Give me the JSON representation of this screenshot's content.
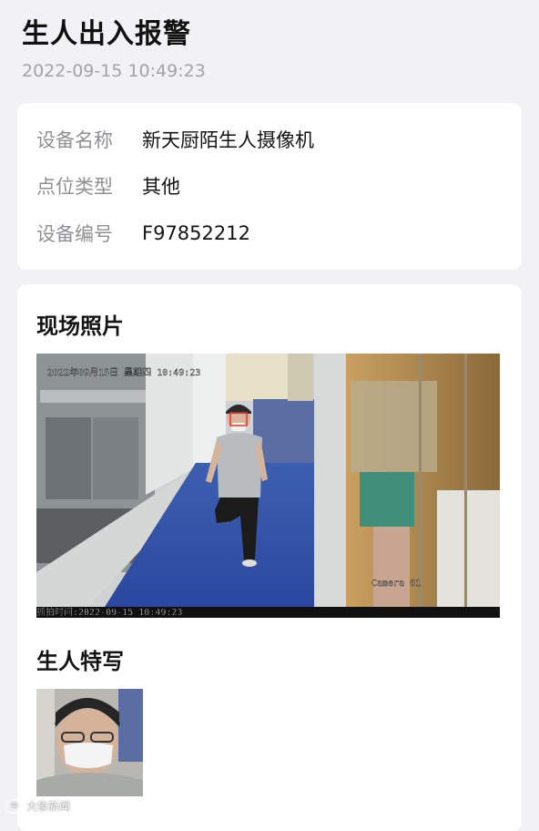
{
  "header": {
    "title": "生人出入报警",
    "timestamp": "2022-09-15 10:49:23"
  },
  "device_info": {
    "rows": [
      {
        "label": "设备名称",
        "value": "新天厨陌生人摄像机"
      },
      {
        "label": "点位类型",
        "value": "其他"
      },
      {
        "label": "设备编号",
        "value": "F97852212"
      }
    ]
  },
  "scene_photo": {
    "section_title": "现场照片",
    "osd_datetime": "2022年09月15日  星期四  10:49:23",
    "camera_label": "Camera 01",
    "capture_caption": "抓拍时间:2022-09-15 10:49:23"
  },
  "face_closeup": {
    "section_title": "生人特写"
  },
  "watermark": {
    "text": "大象新闻"
  }
}
